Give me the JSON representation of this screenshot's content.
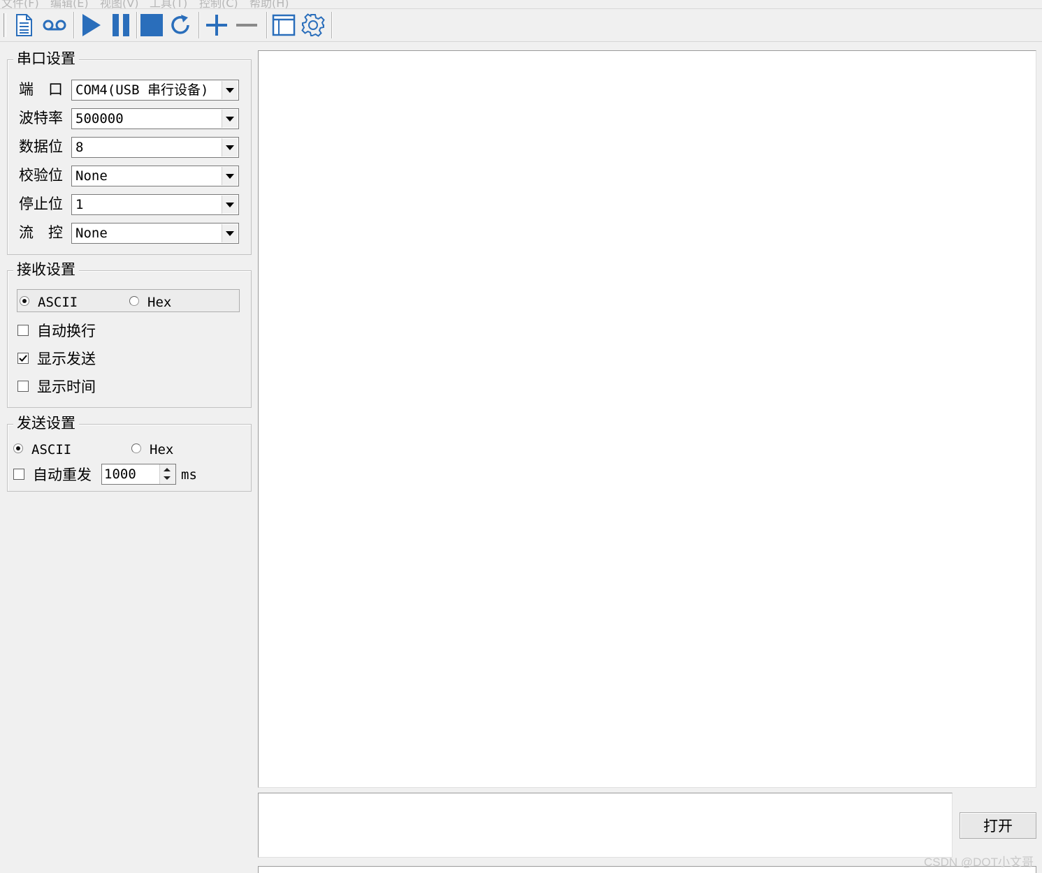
{
  "menu": {
    "items": [
      "文件(F)",
      "编辑(E)",
      "视图(V)",
      "工具(T)",
      "控制(C)",
      "帮助(H)"
    ]
  },
  "toolbar": {
    "buttons": [
      "new-file-icon",
      "voicemail-icon",
      "play-icon",
      "pause-icon",
      "stop-icon",
      "refresh-icon",
      "add-icon",
      "remove-icon",
      "window-icon",
      "settings-icon"
    ],
    "accent_color": "#2a6ebb"
  },
  "serial_settings": {
    "title": "串口设置",
    "port": {
      "label": "端　口",
      "value": "COM4(USB 串行设备)"
    },
    "baud": {
      "label": "波特率",
      "value": "500000"
    },
    "data_bits": {
      "label": "数据位",
      "value": "8"
    },
    "parity": {
      "label": "校验位",
      "value": "None"
    },
    "stop_bits": {
      "label": "停止位",
      "value": "1"
    },
    "flow_control": {
      "label": "流　控",
      "value": "None"
    }
  },
  "receive_settings": {
    "title": "接收设置",
    "mode_ascii": "ASCII",
    "mode_hex": "Hex",
    "selected_mode": "ASCII",
    "auto_wrap": {
      "label": "自动换行",
      "checked": false
    },
    "show_sent": {
      "label": "显示发送",
      "checked": true
    },
    "show_time": {
      "label": "显示时间",
      "checked": false
    }
  },
  "send_settings": {
    "title": "发送设置",
    "mode_ascii": "ASCII",
    "mode_hex": "Hex",
    "selected_mode": "ASCII",
    "auto_resend": {
      "label": "自动重发",
      "checked": false
    },
    "interval": "1000",
    "interval_unit": "ms"
  },
  "open_button": "打开",
  "watermark": "CSDN @DOT小文哥"
}
